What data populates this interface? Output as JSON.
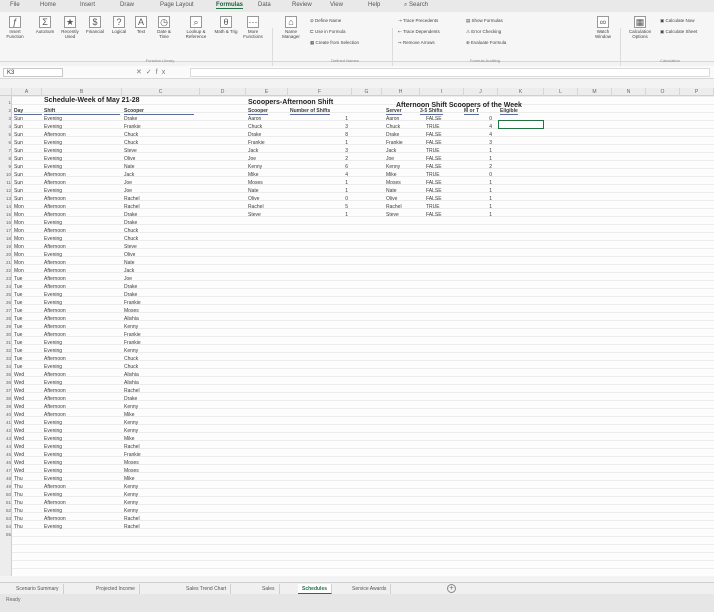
{
  "menu_tabs": [
    "File",
    "Home",
    "Insert",
    "Draw",
    "Page Layout",
    "Formulas",
    "Data",
    "Review",
    "View",
    "Help"
  ],
  "active_tab": "Formulas",
  "search_label": "Search",
  "ribbon": {
    "insert_function": "Insert Function",
    "autosum": "AutoSum",
    "recently_used": "Recently Used",
    "financial": "Financial",
    "logical": "Logical",
    "text": "Text",
    "date_time": "Date & Time",
    "lookup_reference": "Lookup & Reference",
    "math_trig": "Math & Trig",
    "more_functions": "More Functions",
    "function_library": "Function Library",
    "name_manager": "Name Manager",
    "define_name": "Define Name",
    "use_in_formula": "Use in Formula",
    "create_from_selection": "Create from Selection",
    "defined_names": "Defined Names",
    "trace_precedents": "Trace Precedents",
    "trace_dependents": "Trace Dependents",
    "remove_arrows": "Remove Arrows",
    "show_formulas": "Show Formulas",
    "error_checking": "Error Checking",
    "evaluate_formula": "Evaluate Formula",
    "formula_auditing": "Formula Auditing",
    "watch_window": "Watch Window",
    "calculation_options": "Calculation Options",
    "calculate_now": "Calculate Now",
    "calculate_sheet": "Calculate Sheet",
    "calculation": "Calculation"
  },
  "name_box": "K3",
  "fx": "fx",
  "columns": [
    "A",
    "B",
    "C",
    "D",
    "E",
    "F",
    "G",
    "H",
    "I",
    "J",
    "K",
    "L",
    "M",
    "N",
    "O",
    "P"
  ],
  "rows": [
    "1",
    "2",
    "3",
    "4",
    "5",
    "6",
    "7",
    "8",
    "9",
    "10",
    "11",
    "12",
    "13",
    "14",
    "15",
    "16",
    "17",
    "18",
    "19",
    "20",
    "21",
    "22",
    "23",
    "24",
    "25",
    "26",
    "27",
    "28",
    "29",
    "30",
    "31",
    "32",
    "33",
    "34",
    "35",
    "36",
    "37",
    "38",
    "39",
    "40",
    "41",
    "42",
    "43",
    "44",
    "45",
    "46",
    "47",
    "48",
    "49",
    "50",
    "51",
    "52",
    "53",
    "54",
    "55"
  ],
  "schedule": {
    "title": "Schedule-Week of May 21-28",
    "headers": [
      "Day",
      "Shift",
      "Scooper"
    ],
    "rows": [
      [
        "Sun",
        "Evening",
        "Drake"
      ],
      [
        "Sun",
        "Evening",
        "Frankie"
      ],
      [
        "Sun",
        "Afternoon",
        "Chuck"
      ],
      [
        "Sun",
        "Evening",
        "Chuck"
      ],
      [
        "Sun",
        "Evening",
        "Steve"
      ],
      [
        "Sun",
        "Evening",
        "Olive"
      ],
      [
        "Sun",
        "Evening",
        "Nate"
      ],
      [
        "Sun",
        "Afternoon",
        "Jack"
      ],
      [
        "Sun",
        "Afternoon",
        "Joe"
      ],
      [
        "Sun",
        "Evening",
        "Joe"
      ],
      [
        "Sun",
        "Afternoon",
        "Rachel"
      ],
      [
        "Mon",
        "Afternoon",
        "Rachel"
      ],
      [
        "Mon",
        "Afternoon",
        "Drake"
      ],
      [
        "Mon",
        "Evening",
        "Drake"
      ],
      [
        "Mon",
        "Afternoon",
        "Chuck"
      ],
      [
        "Mon",
        "Evening",
        "Chuck"
      ],
      [
        "Mon",
        "Afternoon",
        "Steve"
      ],
      [
        "Mon",
        "Evening",
        "Olive"
      ],
      [
        "Mon",
        "Afternoon",
        "Nate"
      ],
      [
        "Mon",
        "Afternoon",
        "Jack"
      ],
      [
        "Tue",
        "Afternoon",
        "Joe"
      ],
      [
        "Tue",
        "Afternoon",
        "Drake"
      ],
      [
        "Tue",
        "Evening",
        "Drake"
      ],
      [
        "Tue",
        "Evening",
        "Frankie"
      ],
      [
        "Tue",
        "Afternoon",
        "Moses"
      ],
      [
        "Tue",
        "Afternoon",
        "Alishia"
      ],
      [
        "Tue",
        "Afternoon",
        "Kenny"
      ],
      [
        "Tue",
        "Afternoon",
        "Frankie"
      ],
      [
        "Tue",
        "Evening",
        "Frankie"
      ],
      [
        "Tue",
        "Evening",
        "Kenny"
      ],
      [
        "Tue",
        "Afternoon",
        "Chuck"
      ],
      [
        "Tue",
        "Evening",
        "Chuck"
      ],
      [
        "Wed",
        "Afternoon",
        "Alishia"
      ],
      [
        "Wed",
        "Evening",
        "Alishia"
      ],
      [
        "Wed",
        "Afternoon",
        "Rachel"
      ],
      [
        "Wed",
        "Afternoon",
        "Drake"
      ],
      [
        "Wed",
        "Afternoon",
        "Kenny"
      ],
      [
        "Wed",
        "Afternoon",
        "Mike"
      ],
      [
        "Wed",
        "Evening",
        "Kenny"
      ],
      [
        "Wed",
        "Evening",
        "Kenny"
      ],
      [
        "Wed",
        "Evening",
        "Mike"
      ],
      [
        "Wed",
        "Evening",
        "Rachel"
      ],
      [
        "Wed",
        "Evening",
        "Frankie"
      ],
      [
        "Wed",
        "Evening",
        "Moses"
      ],
      [
        "Wed",
        "Evening",
        "Moses"
      ],
      [
        "Thu",
        "Evening",
        "Mike"
      ],
      [
        "Thu",
        "Afternoon",
        "Kenny"
      ],
      [
        "Thu",
        "Evening",
        "Kenny"
      ],
      [
        "Thu",
        "Afternoon",
        "Kenny"
      ],
      [
        "Thu",
        "Evening",
        "Kenny"
      ],
      [
        "Thu",
        "Afternoon",
        "Rachel"
      ],
      [
        "Thu",
        "Evening",
        "Rachel"
      ]
    ]
  },
  "afternoon_shifts": {
    "title": "Scoopers-Afternoon Shift",
    "headers": [
      "Scooper",
      "Number of Shifts"
    ],
    "rows": [
      [
        "Aaron",
        "1"
      ],
      [
        "Chuck",
        "3"
      ],
      [
        "Drake",
        "8"
      ],
      [
        "Frankie",
        "1"
      ],
      [
        "Jack",
        "3"
      ],
      [
        "Joe",
        "2"
      ],
      [
        "Kenny",
        "6"
      ],
      [
        "Mike",
        "4"
      ],
      [
        "Moses",
        "1"
      ],
      [
        "Nate",
        "1"
      ],
      [
        "Olive",
        "0"
      ],
      [
        "Rachel",
        "5"
      ],
      [
        "Steve",
        "1"
      ]
    ]
  },
  "eligibility": {
    "title": "Afternoon Shift Scoopers of the Week",
    "headers": [
      "Server",
      "3-5 Shifts",
      "M or T",
      "Eligible"
    ],
    "rows": [
      [
        "Aaron",
        "FALSE",
        "0",
        ""
      ],
      [
        "Chuck",
        "TRUE",
        "4",
        ""
      ],
      [
        "Drake",
        "FALSE",
        "4",
        ""
      ],
      [
        "Frankie",
        "FALSE",
        "3",
        ""
      ],
      [
        "Jack",
        "TRUE",
        "1",
        ""
      ],
      [
        "Joe",
        "FALSE",
        "1",
        ""
      ],
      [
        "Kenny",
        "FALSE",
        "2",
        ""
      ],
      [
        "Mike",
        "TRUE",
        "0",
        ""
      ],
      [
        "Moses",
        "FALSE",
        "1",
        ""
      ],
      [
        "Nate",
        "FALSE",
        "1",
        ""
      ],
      [
        "Olive",
        "FALSE",
        "1",
        ""
      ],
      [
        "Rachel",
        "TRUE",
        "1",
        ""
      ],
      [
        "Steve",
        "FALSE",
        "1",
        ""
      ]
    ]
  },
  "sheet_tabs": [
    "Scenario Summary",
    "Projected Income",
    "Sales Trend Chart",
    "Sales",
    "Schedules",
    "Service Awards"
  ],
  "active_sheet": "Schedules",
  "status_text": "Ready"
}
